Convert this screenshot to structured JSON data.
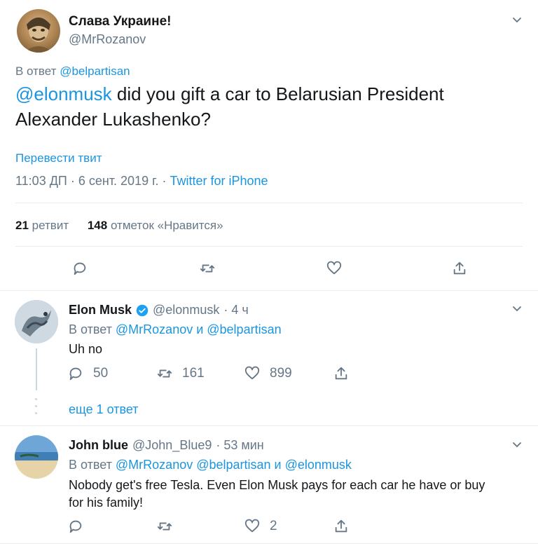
{
  "main_tweet": {
    "display_name": "Слава Украине!",
    "handle": "@MrRozanov",
    "reply_prefix": "В ответ",
    "reply_to": "@belpartisan",
    "mention": "@elonmusk",
    "text_line1": " did you gift a car to Belarusian President",
    "text_line2": "Alexander Lukashenko?",
    "translate": "Перевести твит",
    "time_date": "11:03 ДП · 6 сент. 2019 г. ·",
    "source": "Twitter for iPhone",
    "retweet_count": "21",
    "retweet_label": "ретвит",
    "like_count": "148",
    "like_label": "отметок «Нравится»"
  },
  "reply1": {
    "display_name": "Elon Musk",
    "handle": "@elonmusk",
    "time": "· 4 ч",
    "reply_prefix": "В ответ",
    "reply_to": "@MrRozanov и @belpartisan",
    "text": "Uh no",
    "replies": "50",
    "retweets": "161",
    "likes": "899",
    "more_replies": "еще 1 ответ"
  },
  "reply2": {
    "display_name": "John blue",
    "handle": "@John_Blue9",
    "time": "· 53 мин",
    "reply_prefix": "В ответ",
    "reply_to": "@MrRozanov @belpartisan и @elonmusk",
    "text_line1": "Nobody get's free Tesla. Even Elon Musk pays for each car he have or buy",
    "text_line2": "for his family!",
    "likes": "2"
  },
  "colors": {
    "link": "#1b95e0",
    "muted": "#657786",
    "divider": "#e6ecf0",
    "verified": "#1da1f2"
  },
  "icons": [
    "chevron-down-icon",
    "reply-icon",
    "retweet-icon",
    "like-icon",
    "share-icon",
    "verified-badge-icon"
  ]
}
